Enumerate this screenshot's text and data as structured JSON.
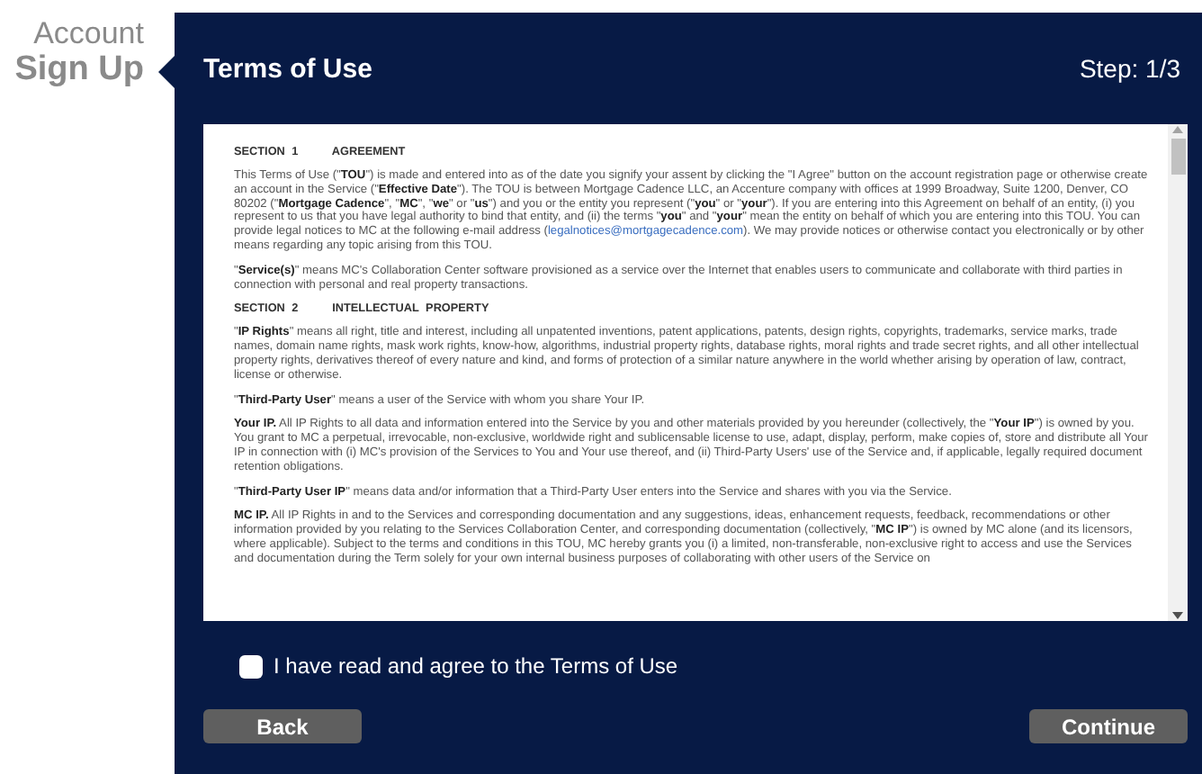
{
  "side_label": {
    "line_1": "Account",
    "line_2": "Sign Up"
  },
  "panel": {
    "title": "Terms of Use",
    "step": "Step: 1/3"
  },
  "document": {
    "blocks": [
      {
        "kind": "heading",
        "text": "SECTION 1     AGREEMENT"
      },
      {
        "kind": "paragraph",
        "text": "This Terms of Use (\"**TOU**\") is made and entered into as of the date you signify your assent by clicking the \"I Agree\" button on the account registration page or otherwise create an account in the Service (\"**Effective Date**\"). The TOU is between Mortgage Cadence LLC, an Accenture company with offices at 1999 Broadway, Suite 1200, Denver, CO 80202 (\"**Mortgage Cadence**\", \"**MC**\", \"**we**\" or \"**us**\") and you or the entity you represent (\"**you**\" or \"**your**\"). If you are entering into this Agreement on behalf of an entity, (i) you represent to us that you have legal authority to bind that entity, and (ii) the terms \"**you**\" and \"**your**\" mean the entity on behalf of which you are entering into this TOU. You can provide legal notices to MC at the following e-mail address (",
        "link": "legalnotices@mortgagecadence.com",
        "text_after": "). We may provide notices or otherwise contact you electronically or by other means regarding any topic arising from this TOU."
      },
      {
        "kind": "paragraph",
        "text": "\"**Service(s)**\" means MC's Collaboration Center software provisioned as a service over the Internet that enables users to communicate and collaborate with third parties in connection with personal and real property transactions."
      },
      {
        "kind": "heading",
        "text": "SECTION 2     INTELLECTUAL PROPERTY"
      },
      {
        "kind": "paragraph",
        "text": "\"**IP Rights**\" means all right, title and interest, including all unpatented inventions, patent applications, patents, design rights, copyrights, trademarks, service marks, trade names, domain name rights, mask work rights, know-how, algorithms, industrial property rights, database rights, moral rights and trade secret rights, and all other intellectual property rights, derivatives thereof of every nature and kind, and forms of protection of a similar nature anywhere in the world whether arising by operation of law, contract, license or otherwise."
      },
      {
        "kind": "paragraph",
        "text": "\"**Third-Party User**\" means a user of the Service with whom you share Your IP."
      },
      {
        "kind": "paragraph",
        "text": "**Your IP.** All IP Rights to all data and information entered into the Service by you and other materials provided by you hereunder (collectively, the \"**Your IP**\") is owned by you. You grant to MC a perpetual, irrevocable, non-exclusive, worldwide right and sublicensable license to use, adapt, display, perform, make copies of, store and distribute all Your IP in connection with (i) MC's provision of the Services to You and Your use thereof, and (ii) Third-Party Users' use of the Service and, if applicable, legally required document retention obligations."
      },
      {
        "kind": "paragraph",
        "text": "\"**Third-Party User IP**\" means data and/or information that a Third-Party User enters into the Service and shares with you via the Service."
      },
      {
        "kind": "paragraph",
        "text": "**MC IP.** All IP Rights in and to the Services and corresponding documentation and any suggestions, ideas, enhancement requests, feedback, recommendations or other information provided by you relating to the Services Collaboration Center, and corresponding documentation (collectively, \"**MC IP**\") is owned by MC alone (and its licensors, where applicable). Subject to the terms and conditions in this TOU, MC hereby grants you (i) a limited, non-transferable, non-exclusive right to access and use the Services and documentation during the Term solely for your own internal business purposes of collaborating with other users of the Service on"
      }
    ]
  },
  "agree": {
    "label": "I have read and agree to the Terms of Use",
    "checked": false
  },
  "buttons": {
    "back": "Back",
    "continue": "Continue"
  }
}
